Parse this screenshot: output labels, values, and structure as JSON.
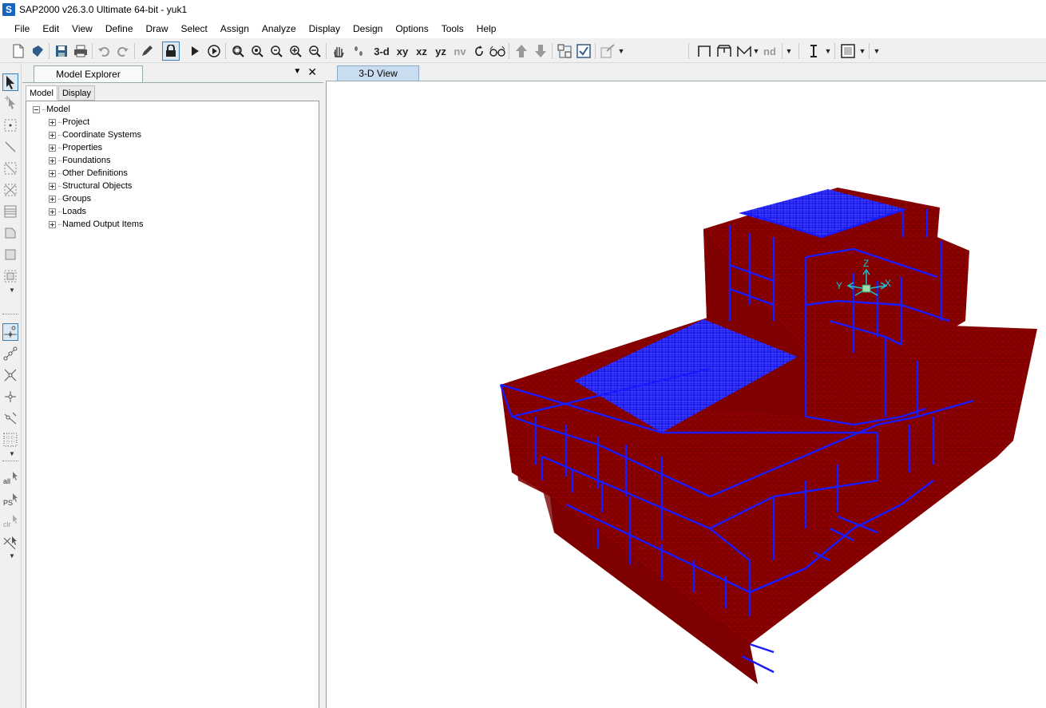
{
  "window": {
    "title": "SAP2000 v26.3.0 Ultimate 64-bit - yuk1",
    "logo": "S"
  },
  "menu": [
    "File",
    "Edit",
    "View",
    "Define",
    "Draw",
    "Select",
    "Assign",
    "Analyze",
    "Display",
    "Design",
    "Options",
    "Tools",
    "Help"
  ],
  "toolbar": {
    "view_buttons": [
      "3-d",
      "xy",
      "xz",
      "yz",
      "nv"
    ],
    "section_label": "nd"
  },
  "explorer": {
    "title": "Model Explorer",
    "tabs": [
      "Model",
      "Display"
    ],
    "root": "Model",
    "items": [
      "Project",
      "Coordinate Systems",
      "Properties",
      "Foundations",
      "Other Definitions",
      "Structural Objects",
      "Groups",
      "Loads",
      "Named Output Items"
    ]
  },
  "view": {
    "tab_label": "3-D View",
    "axes": {
      "z": "Z",
      "y": "Y",
      "x": "X"
    }
  },
  "colors": {
    "mesh": "#8b0000",
    "frames": "#1a1aff",
    "axes": "#19c3d8",
    "accent": "#3c7fb1"
  }
}
